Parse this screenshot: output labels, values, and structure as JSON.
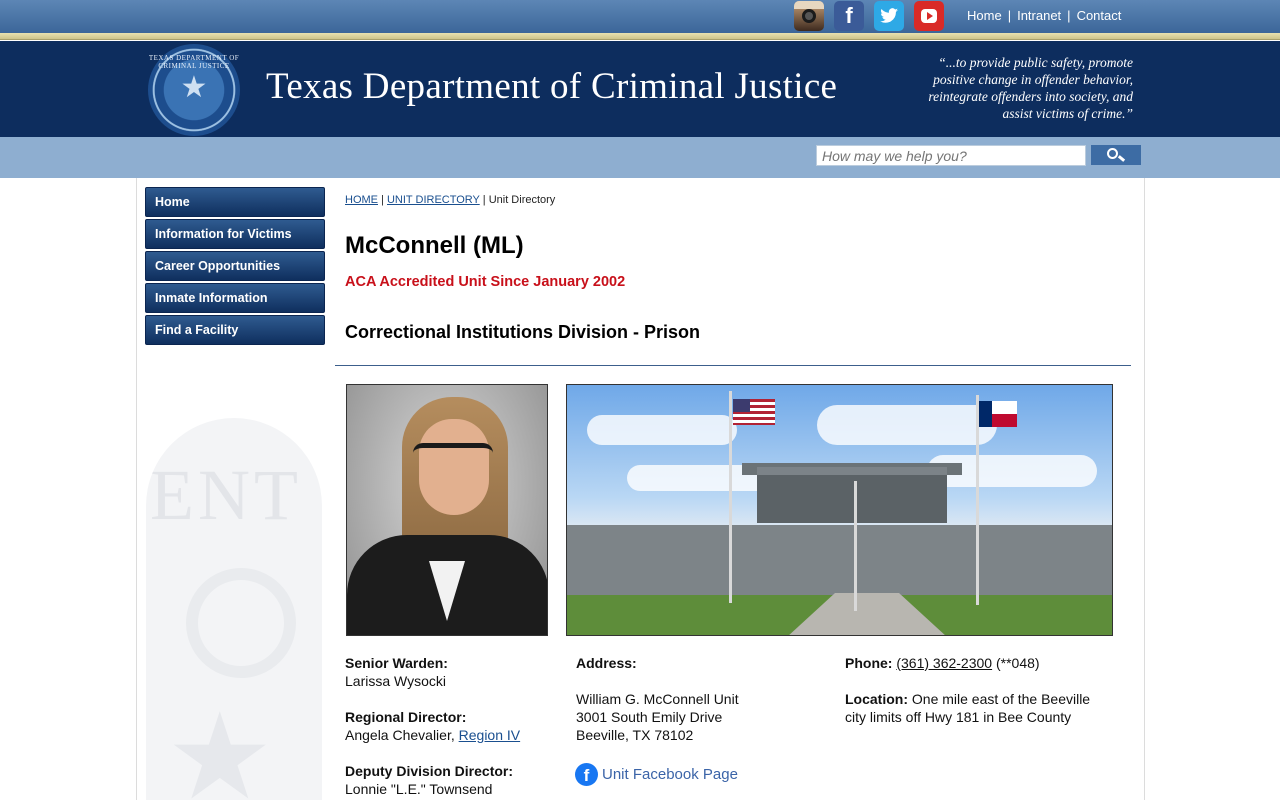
{
  "top_links": {
    "home": "Home",
    "intranet": "Intranet",
    "contact": "Contact",
    "separator": "|"
  },
  "social": {
    "instagram_icon": "instagram-icon",
    "facebook_icon": "facebook-icon",
    "twitter_icon": "twitter-icon",
    "youtube_icon": "youtube-icon"
  },
  "header": {
    "seal_text": "TEXAS DEPARTMENT OF CRIMINAL JUSTICE",
    "title": "Texas Department of Criminal Justice",
    "motto": "“...to provide public safety, promote positive change in offender behavior, reintegrate offenders into society, and assist victims of crime.”"
  },
  "search": {
    "placeholder": "How may we help you?"
  },
  "nav": {
    "items": [
      {
        "label": "Home"
      },
      {
        "label": "Information for Victims"
      },
      {
        "label": "Career Opportunities"
      },
      {
        "label": "Inmate Information"
      },
      {
        "label": "Find a Facility"
      }
    ]
  },
  "breadcrumb": {
    "home": "HOME",
    "sep1": " | ",
    "unit_directory": "UNIT DIRECTORY",
    "sep2": " | ",
    "current": "Unit Directory"
  },
  "unit": {
    "title": "McConnell (ML)",
    "accreditation": "ACA Accredited Unit Since January 2002",
    "division": "Correctional Institutions Division - Prison"
  },
  "staff": {
    "senior_warden_label": "Senior Warden:",
    "senior_warden": "Larissa Wysocki",
    "regional_director_label": "Regional Director:",
    "regional_director": "Angela Chevalier,",
    "region_link": "Region IV",
    "deputy_director_label": "Deputy Division Director:",
    "deputy_director": "Lonnie \"L.E.\" Townsend"
  },
  "address": {
    "label": "Address:",
    "line1": "William G. McConnell Unit",
    "line2": "3001 South Emily Drive",
    "line3": "Beeville, TX 78102"
  },
  "facebook": {
    "icon": "facebook-icon",
    "label": "Unit Facebook Page"
  },
  "contact": {
    "phone_label": "Phone:",
    "phone": "(361) 362-2300",
    "phone_ext": "(**048)",
    "location_label": "Location:",
    "location": "One mile east of the Beeville city limits off Hwy 181 in Bee County"
  },
  "colors": {
    "header_navy": "#0d2d5e",
    "accent_red": "#c8101a",
    "nav_blue": "#1f4575",
    "search_band": "#8eaed0"
  }
}
